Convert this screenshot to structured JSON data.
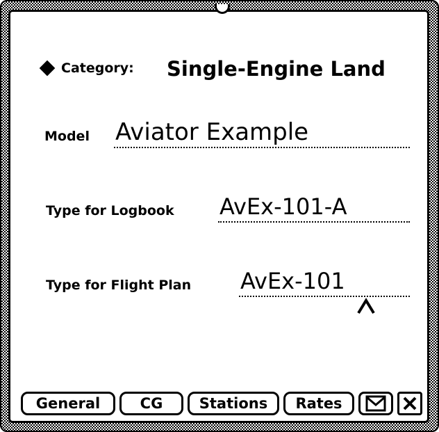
{
  "fields": {
    "category": {
      "label": "Category:",
      "value": "Single-Engine Land"
    },
    "model": {
      "label": "Model",
      "value": "Aviator Example"
    },
    "type_logbook": {
      "label": "Type for Logbook",
      "value": "AvEx-101-A"
    },
    "type_flightplan": {
      "label": "Type for Flight Plan",
      "value": "AvEx-101"
    }
  },
  "buttons": {
    "general": "General",
    "cg": "CG",
    "stations": "Stations",
    "rates": "Rates"
  },
  "icons": {
    "category_marker": "diamond-icon",
    "insertion_caret": "caret-icon",
    "routing": "envelope-icon",
    "close": "close-icon"
  }
}
